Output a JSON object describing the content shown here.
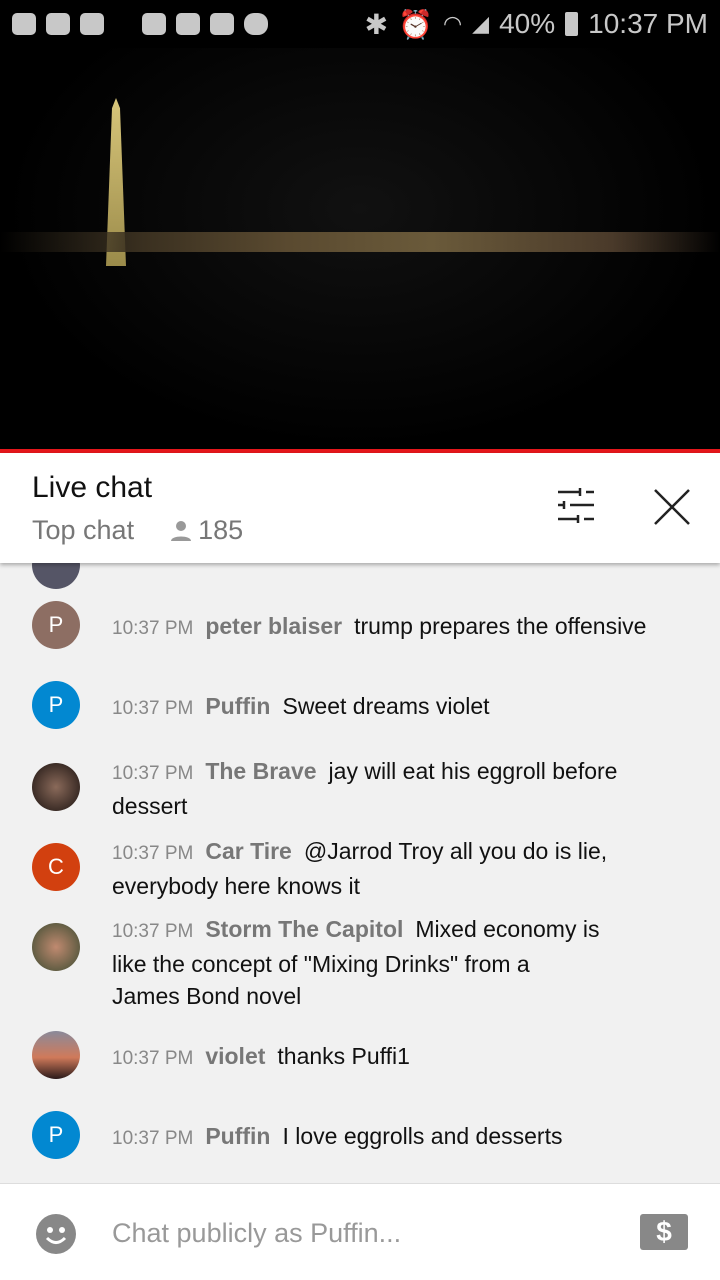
{
  "status_bar": {
    "battery": "40%",
    "time": "10:37 PM",
    "icons": [
      "youtube-icon",
      "m-app-icon",
      "youtube-icon",
      "missed-call-icon",
      "folder-icon",
      "warning-icon",
      "image-icon",
      "cloud-icon",
      "bluetooth-icon",
      "alarm-icon",
      "wifi-icon",
      "signal-icon",
      "battery-icon"
    ]
  },
  "header": {
    "title": "Live chat",
    "mode": "Top chat",
    "viewers": "185"
  },
  "messages": [
    {
      "time": "10:37 PM",
      "author": "peter blaiser",
      "text": "trump prepares the offensive",
      "avatar": "P",
      "color": "#8d6e63"
    },
    {
      "time": "10:37 PM",
      "author": "Puffin",
      "text": "Sweet dreams violet",
      "avatar": "P",
      "color": "#0288d1"
    },
    {
      "time": "10:37 PM",
      "author": "The Brave",
      "text": "jay will eat his eggroll before dessert",
      "avatar": "",
      "color": "#3b2a22"
    },
    {
      "time": "10:37 PM",
      "author": "Car Tire",
      "text": "@Jarrod Troy all you do is lie, everybody here knows it",
      "avatar": "C",
      "color": "#d2400f"
    },
    {
      "time": "10:37 PM",
      "author": "Storm The Capitol",
      "text": "Mixed economy is like the concept of \"Mixing Drinks\" from a James Bond novel",
      "avatar": "",
      "color": "#7a6656"
    },
    {
      "time": "10:37 PM",
      "author": "violet",
      "text": "thanks Puffi1",
      "avatar": "",
      "color": "#c77a5a"
    },
    {
      "time": "10:37 PM",
      "author": "Puffin",
      "text": "I love eggrolls and desserts",
      "avatar": "P",
      "color": "#0288d1"
    }
  ],
  "footer": {
    "placeholder": "Chat publicly as Puffin..."
  },
  "colors": {
    "accent": "#e5161b"
  }
}
